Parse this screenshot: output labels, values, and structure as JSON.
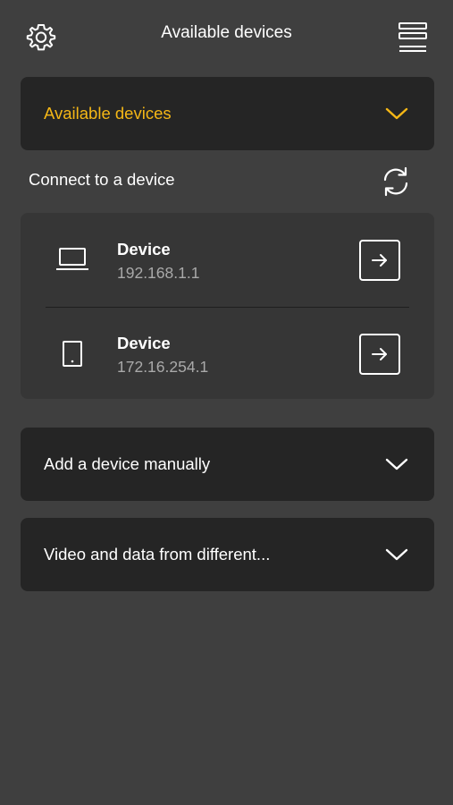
{
  "header": {
    "title": "Available devices",
    "left_icon": "gear-icon",
    "right_icon": "menu-icon"
  },
  "available_panel": {
    "label": "Available devices",
    "expanded": true,
    "icon": "chevron-down-icon"
  },
  "connect_section": {
    "label": "Connect to a device",
    "refresh_icon": "refresh-icon"
  },
  "devices": [
    {
      "name": "Device",
      "ip": "192.168.1.1",
      "icon": "laptop-icon",
      "action_icon": "arrow-right-icon"
    },
    {
      "name": "Device",
      "ip": "172.16.254.1",
      "icon": "tablet-icon",
      "action_icon": "arrow-right-icon"
    }
  ],
  "manual_panel": {
    "label": "Add a device manually",
    "icon": "chevron-down-icon"
  },
  "video_panel": {
    "label": "Video and data from different...",
    "icon": "chevron-down-icon"
  },
  "colors": {
    "background": "#3f3f3f",
    "panel": "#252525",
    "device_list": "#363636",
    "accent": "#f5b716",
    "secondary_text": "#a9a9a9"
  }
}
